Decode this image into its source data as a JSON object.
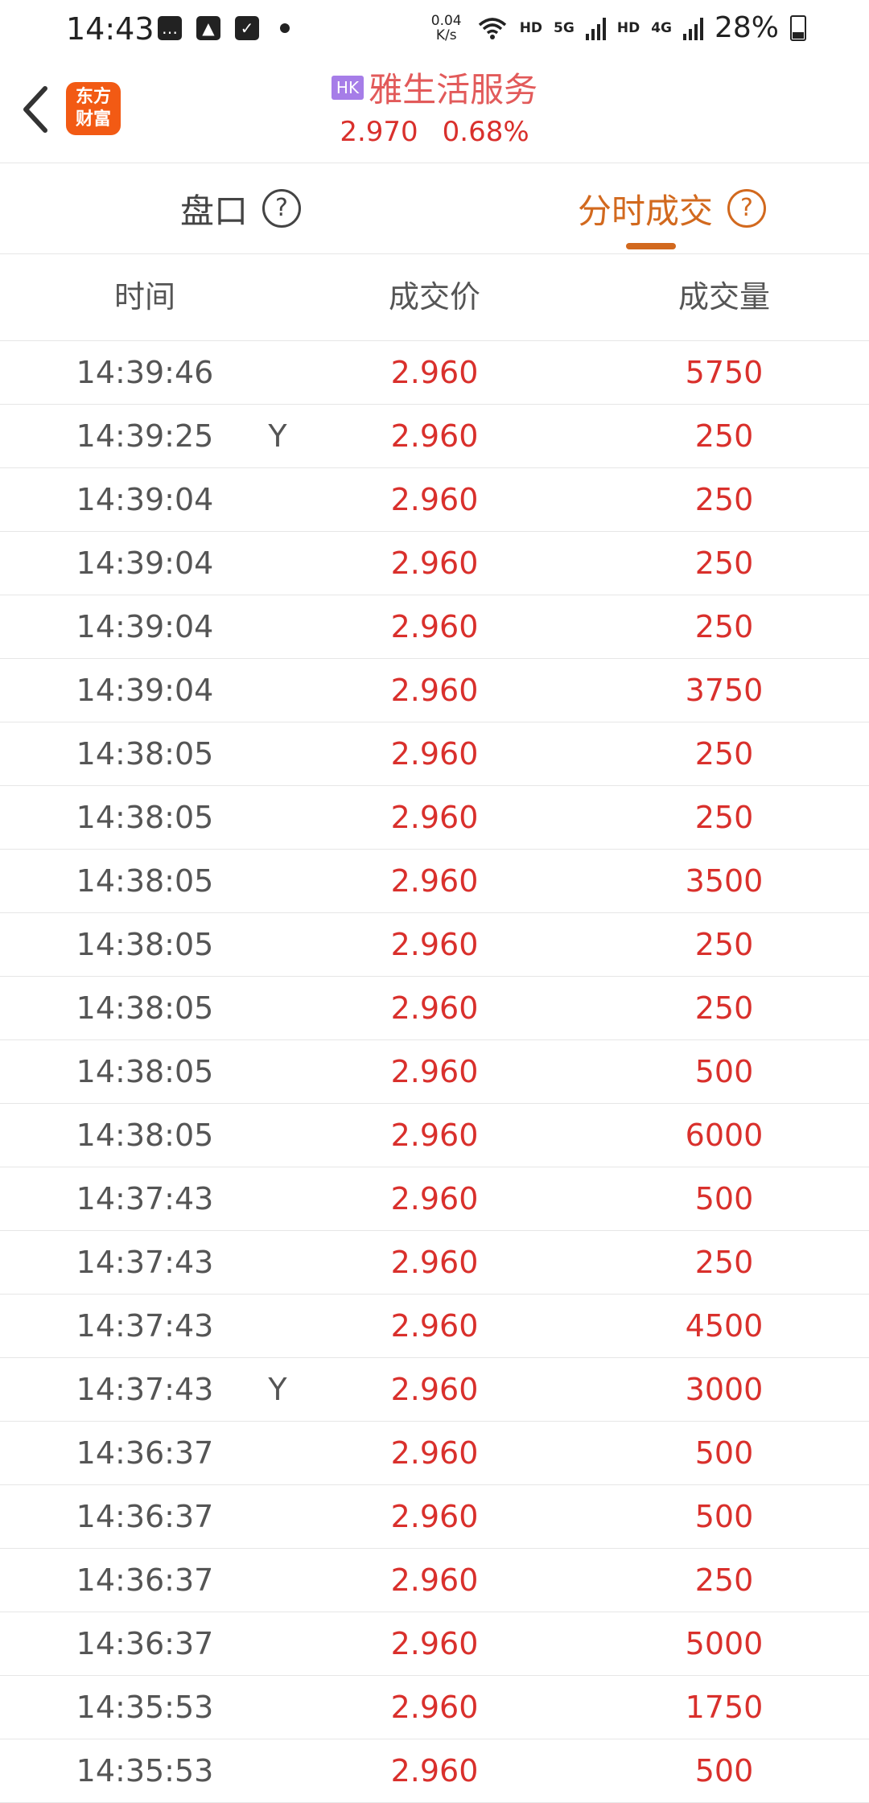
{
  "status_bar": {
    "time": "14:43",
    "net_speed_value": "0.04",
    "net_speed_unit": "K/s",
    "hd1": "HD",
    "net1": "5G",
    "hd2": "HD",
    "net2": "4G",
    "battery": "28%"
  },
  "header": {
    "logo_line1": "东方",
    "logo_line2": "财富",
    "market_badge": "HK",
    "stock_name": "雅生活服务",
    "price": "2.970",
    "change_pct": "0.68%"
  },
  "tabs": [
    {
      "label": "盘口",
      "help": "?"
    },
    {
      "label": "分时成交",
      "help": "?"
    }
  ],
  "columns": {
    "time": "时间",
    "price": "成交价",
    "volume": "成交量"
  },
  "rows": [
    {
      "time": "14:39:46",
      "flag": "",
      "price": "2.960",
      "volume": "5750"
    },
    {
      "time": "14:39:25",
      "flag": "Y",
      "price": "2.960",
      "volume": "250"
    },
    {
      "time": "14:39:04",
      "flag": "",
      "price": "2.960",
      "volume": "250"
    },
    {
      "time": "14:39:04",
      "flag": "",
      "price": "2.960",
      "volume": "250"
    },
    {
      "time": "14:39:04",
      "flag": "",
      "price": "2.960",
      "volume": "250"
    },
    {
      "time": "14:39:04",
      "flag": "",
      "price": "2.960",
      "volume": "3750"
    },
    {
      "time": "14:38:05",
      "flag": "",
      "price": "2.960",
      "volume": "250"
    },
    {
      "time": "14:38:05",
      "flag": "",
      "price": "2.960",
      "volume": "250"
    },
    {
      "time": "14:38:05",
      "flag": "",
      "price": "2.960",
      "volume": "3500"
    },
    {
      "time": "14:38:05",
      "flag": "",
      "price": "2.960",
      "volume": "250"
    },
    {
      "time": "14:38:05",
      "flag": "",
      "price": "2.960",
      "volume": "250"
    },
    {
      "time": "14:38:05",
      "flag": "",
      "price": "2.960",
      "volume": "500"
    },
    {
      "time": "14:38:05",
      "flag": "",
      "price": "2.960",
      "volume": "6000"
    },
    {
      "time": "14:37:43",
      "flag": "",
      "price": "2.960",
      "volume": "500"
    },
    {
      "time": "14:37:43",
      "flag": "",
      "price": "2.960",
      "volume": "250"
    },
    {
      "time": "14:37:43",
      "flag": "",
      "price": "2.960",
      "volume": "4500"
    },
    {
      "time": "14:37:43",
      "flag": "Y",
      "price": "2.960",
      "volume": "3000"
    },
    {
      "time": "14:36:37",
      "flag": "",
      "price": "2.960",
      "volume": "500"
    },
    {
      "time": "14:36:37",
      "flag": "",
      "price": "2.960",
      "volume": "500"
    },
    {
      "time": "14:36:37",
      "flag": "",
      "price": "2.960",
      "volume": "250"
    },
    {
      "time": "14:36:37",
      "flag": "",
      "price": "2.960",
      "volume": "5000"
    },
    {
      "time": "14:35:53",
      "flag": "",
      "price": "2.960",
      "volume": "1750"
    },
    {
      "time": "14:35:53",
      "flag": "",
      "price": "2.960",
      "volume": "500"
    }
  ]
}
